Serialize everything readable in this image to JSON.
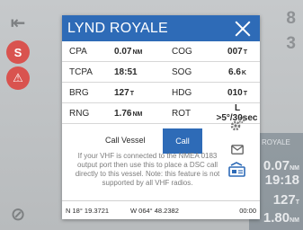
{
  "background": {
    "right_numbers": [
      "8",
      "3"
    ],
    "vessel_label": "D ROYALE",
    "readouts": [
      {
        "value": "0.07",
        "unit": "NM"
      },
      {
        "value": "19:18",
        "unit": ""
      },
      {
        "value": "127",
        "unit": "T"
      },
      {
        "value": "1.80",
        "unit": "NM"
      }
    ]
  },
  "dialog": {
    "title": "LYND ROYALE",
    "rows": [
      {
        "l1": "CPA",
        "v1": "0.07",
        "u1": "NM",
        "l2": "COG",
        "v2": "007",
        "u2": "T"
      },
      {
        "l1": "TCPA",
        "v1": "18:51",
        "u1": "",
        "l2": "SOG",
        "v2": "6.6",
        "u2": "K"
      },
      {
        "l1": "BRG",
        "v1": "127",
        "u1": "T",
        "l2": "HDG",
        "v2": "010",
        "u2": "T"
      },
      {
        "l1": "RNG",
        "v1": "1.76",
        "u1": "NM",
        "l2": "ROT",
        "v2": "L >5°/30sec",
        "u2": ""
      }
    ],
    "call_label": "Call Vessel",
    "call_button": "Call",
    "info_text": "If your VHF is connected to the NMEA 0183 output port then use this to place a DSC call directly to this vessel. Note: this feature is not supported by all VHF radios.",
    "footer": {
      "lat": "N 18° 19.3721",
      "lon": "W 064° 48.2382",
      "time": "00:00"
    }
  },
  "colors": {
    "accent": "#2e6bb7",
    "red": "#d9534f"
  }
}
